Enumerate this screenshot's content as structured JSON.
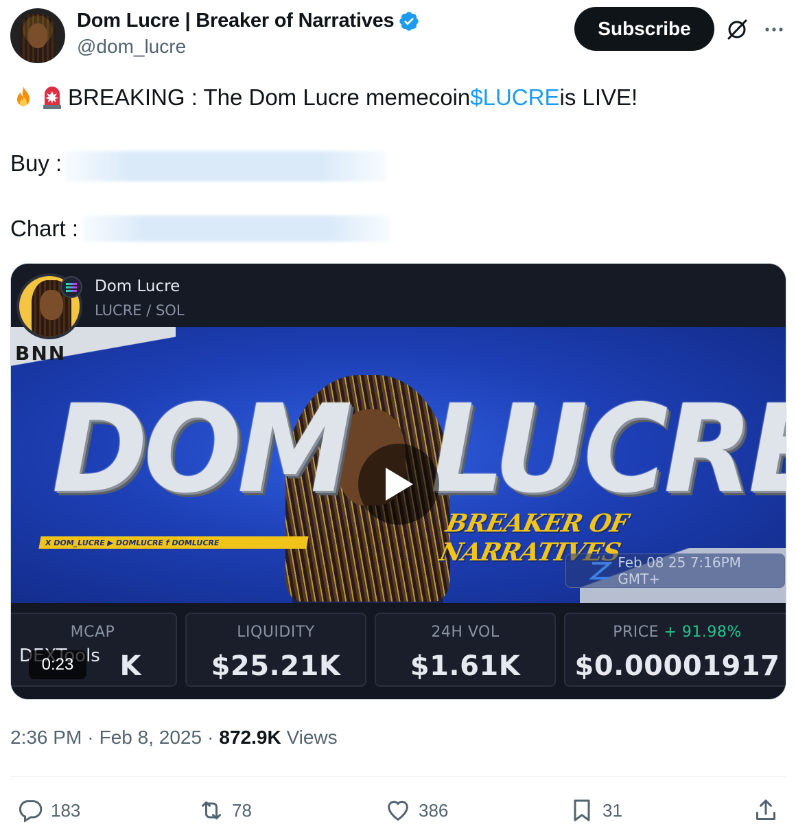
{
  "header": {
    "display_name": "Dom Lucre | Breaker of Narratives",
    "handle": "@dom_lucre",
    "subscribe_label": "Subscribe",
    "verified_color": "#1d9bf0"
  },
  "tweet": {
    "line1_prefix": "BREAKING : The Dom Lucre memecoin ",
    "cashtag": "$LUCRE",
    "line1_suffix": " is LIVE!",
    "buy_label": "Buy :",
    "chart_label": "Chart :",
    "emojis": [
      "fire-emoji",
      "siren-emoji"
    ]
  },
  "media": {
    "profile_name": "Dom Lucre",
    "pair": "LUCRE / SOL",
    "banner_left_word": "DOM",
    "banner_right_word": "LUCRE",
    "banner_tagline": "BREAKER OF NARRATIVES",
    "banner_channel": "BNN",
    "social_strip": "X DOM_LUCRE  ▶ DOMLUCRE  f DOMLUCRE",
    "timestamp_overlay": "Feb 08 25 7:16PM GMT+",
    "stats": {
      "mcap_label": "MCAP",
      "mcap_value": "K",
      "liquidity_label": "LIQUIDITY",
      "liquidity_value": "$25.21K",
      "vol_label": "24H VOL",
      "vol_value": "$1.61K",
      "price_label": "PRICE",
      "price_change": "+ 91.98%",
      "price_value": "$0.00001917"
    },
    "watermark": "DEXTools",
    "duration": "0:23"
  },
  "meta": {
    "time": "2:36 PM",
    "sep": "·",
    "date": "Feb 8, 2025",
    "views_count": "872.9K",
    "views_label": "Views"
  },
  "actions": {
    "replies": "183",
    "retweets": "78",
    "likes": "386",
    "bookmarks": "31"
  }
}
